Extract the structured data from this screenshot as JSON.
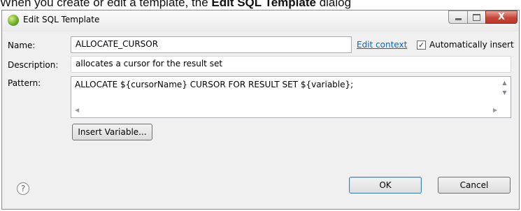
{
  "caption": {
    "before": "When you create or edit a template, the ",
    "bold": "Edit SQL Template",
    "after": " dialog"
  },
  "window": {
    "title": "Edit SQL Template",
    "app_icon": "eclipse-icon",
    "controls": {
      "minimize": "minimize-icon",
      "maximize": "maximize-icon",
      "close": "close-icon",
      "close_glyph": "X"
    }
  },
  "form": {
    "name_label": "Name:",
    "name_value": "ALLOCATE_CURSOR",
    "edit_context_link": "Edit context",
    "auto_insert_checked": true,
    "auto_insert_label": "Automatically insert",
    "description_label": "Description:",
    "description_value": "allocates a cursor for the result set",
    "pattern_label": "Pattern:",
    "pattern_value": "ALLOCATE ${cursorName} CURSOR FOR RESULT SET ${variable};",
    "insert_variable_label": "Insert Variable..."
  },
  "footer": {
    "help_glyph": "?",
    "ok_label": "OK",
    "cancel_label": "Cancel"
  }
}
